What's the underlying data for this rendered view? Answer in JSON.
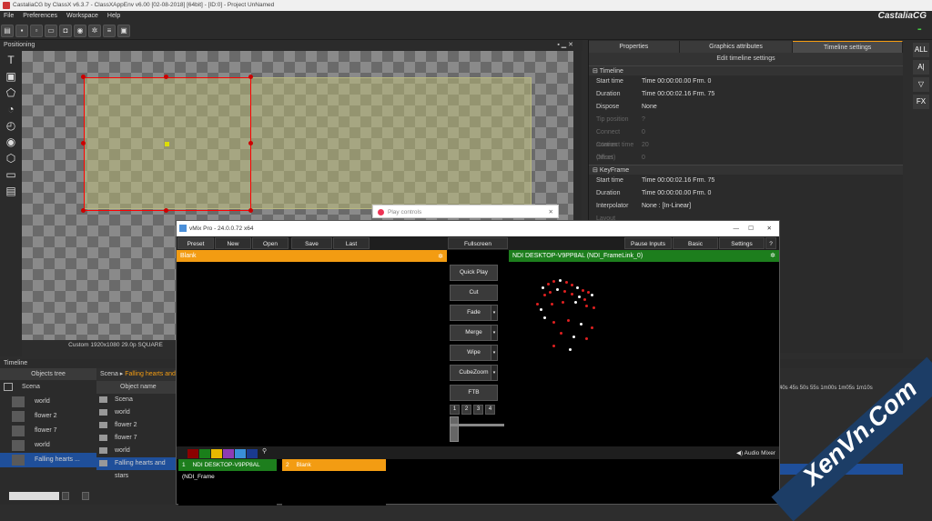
{
  "window": {
    "title": "CastaliaCG by ClassX v6.3.7 - ClassXAppEnv v6.00 [02-08-2018] [64bit] - [ID:0] - Project UnNamed"
  },
  "menu": [
    "File",
    "Preferences",
    "Workspace",
    "Help"
  ],
  "logo": "CastaliaCG",
  "leds": "▪▪▪",
  "toolbar_icons": [
    "open-icon",
    "save-icon",
    "save-as-icon",
    "monitor-icon",
    "camera-icon",
    "eye-icon",
    "settings-icon",
    "database-icon",
    "display-icon"
  ],
  "left_tools": [
    {
      "icon": "text-tool-icon",
      "glyph": "T"
    },
    {
      "icon": "image-tool-icon",
      "glyph": "▣"
    },
    {
      "icon": "polygon-tool-icon",
      "glyph": "⬠"
    },
    {
      "icon": "pie-tool-icon",
      "glyph": "◔"
    },
    {
      "icon": "clock-tool-icon",
      "glyph": "◴"
    },
    {
      "icon": "crawl-tool-icon",
      "glyph": "◉"
    },
    {
      "icon": "cube-tool-icon",
      "glyph": "⬡"
    },
    {
      "icon": "monitor-tool-icon",
      "glyph": "▭"
    },
    {
      "icon": "video-tool-icon",
      "glyph": "▤"
    }
  ],
  "positioning": {
    "title": "Positioning",
    "canvas_info": "Custom 1920x1080 29.0p SQUARE"
  },
  "right_panel": {
    "tabs": [
      "Properties",
      "Graphics attributes",
      "Timeline settings"
    ],
    "active_tab": "Timeline settings",
    "subtitle": "Edit timeline settings",
    "timeline_group": "Timeline",
    "timeline_rows": [
      {
        "key": "Start time",
        "value": "Time 00:00:00.00 Frm. 0"
      },
      {
        "key": "Duration",
        "value": "Time 00:00:02.16 Frm. 75"
      },
      {
        "key": "Dispose",
        "value": "None"
      },
      {
        "key": "Tip position",
        "value": "?",
        "dim": true
      },
      {
        "key": "Connect rotation",
        "value": "0",
        "dim": true
      },
      {
        "key": "Connect time (hh:ss)",
        "value": "20",
        "dim": true
      },
      {
        "key": "Offset",
        "value": "0",
        "dim": true
      }
    ],
    "keyframe_group": "KeyFrame",
    "keyframe_rows": [
      {
        "key": "Start time",
        "value": "Time 00:00:02.16 Frm. 75"
      },
      {
        "key": "Duration",
        "value": "Time 00:00:00.00 Frm. 0"
      },
      {
        "key": "Interpolator",
        "value": "None : [In-Linear]"
      },
      {
        "key": "Layout",
        "value": "",
        "dim": true
      }
    ]
  },
  "right_sidebar": [
    "ALL",
    "A|",
    "▽",
    "FX"
  ],
  "timeline": {
    "title": "Timeline",
    "ruler": "40s 45s 50s 55s 1m00s 1m05s 1m10s"
  },
  "objects_tree": {
    "title": "Objects tree",
    "root": "Scena",
    "items": [
      {
        "label": "world",
        "selected": false
      },
      {
        "label": "flower 2",
        "selected": false
      },
      {
        "label": "flower 7",
        "selected": false
      },
      {
        "label": "world",
        "selected": false
      },
      {
        "label": "Falling hearts ...",
        "selected": true
      }
    ]
  },
  "object_list": {
    "breadcrumb_scene": "Scena",
    "breadcrumb_item": "Falling hearts and",
    "header": "Object name",
    "items": [
      {
        "label": "Scena",
        "selected": false
      },
      {
        "label": "world",
        "selected": false
      },
      {
        "label": "flower 2",
        "selected": false
      },
      {
        "label": "flower 7",
        "selected": false
      },
      {
        "label": "world",
        "selected": false
      },
      {
        "label": "Falling hearts and stars",
        "selected": true
      }
    ]
  },
  "play_controls": {
    "title": "Play controls"
  },
  "vmix": {
    "title": "vMix Pro - 24.0.0.72 x64",
    "toolbar": {
      "preset": "Preset",
      "new": "New",
      "open": "Open",
      "save": "Save",
      "last": "Last",
      "fullscreen": "Fullscreen",
      "pause_inputs": "Pause Inputs",
      "basic": "Basic",
      "settings": "Settings",
      "help": "?"
    },
    "preview_title": "Blank",
    "output_title": "NDI DESKTOP-V9PP8AL (NDI_FrameLink_0)",
    "transitions": [
      {
        "label": "Quick Play",
        "dropdown": false
      },
      {
        "label": "Cut",
        "dropdown": false
      },
      {
        "label": "Fade",
        "dropdown": true
      },
      {
        "label": "Merge",
        "dropdown": true
      },
      {
        "label": "Wipe",
        "dropdown": true
      },
      {
        "label": "CubeZoom",
        "dropdown": true
      },
      {
        "label": "FTB",
        "dropdown": false
      }
    ],
    "numbers": [
      "1",
      "2",
      "3",
      "4"
    ],
    "swatches": [
      "#8b0000",
      "#1a7f1a",
      "#e6b800",
      "#8e3bb5",
      "#3a8fd9",
      "#1a3a8f"
    ],
    "audio_mixer": "Audio Mixer",
    "input1": {
      "number": "1",
      "title": "NDI DESKTOP-V9PP8AL (NDI_Frame"
    },
    "input2": {
      "number": "2",
      "title": "Blank"
    }
  },
  "watermark": "XenVn.Com",
  "colors": {
    "accent_orange": "#f39c12",
    "output_green": "#1d7e1d",
    "selection_blue": "#1f4f9a"
  }
}
